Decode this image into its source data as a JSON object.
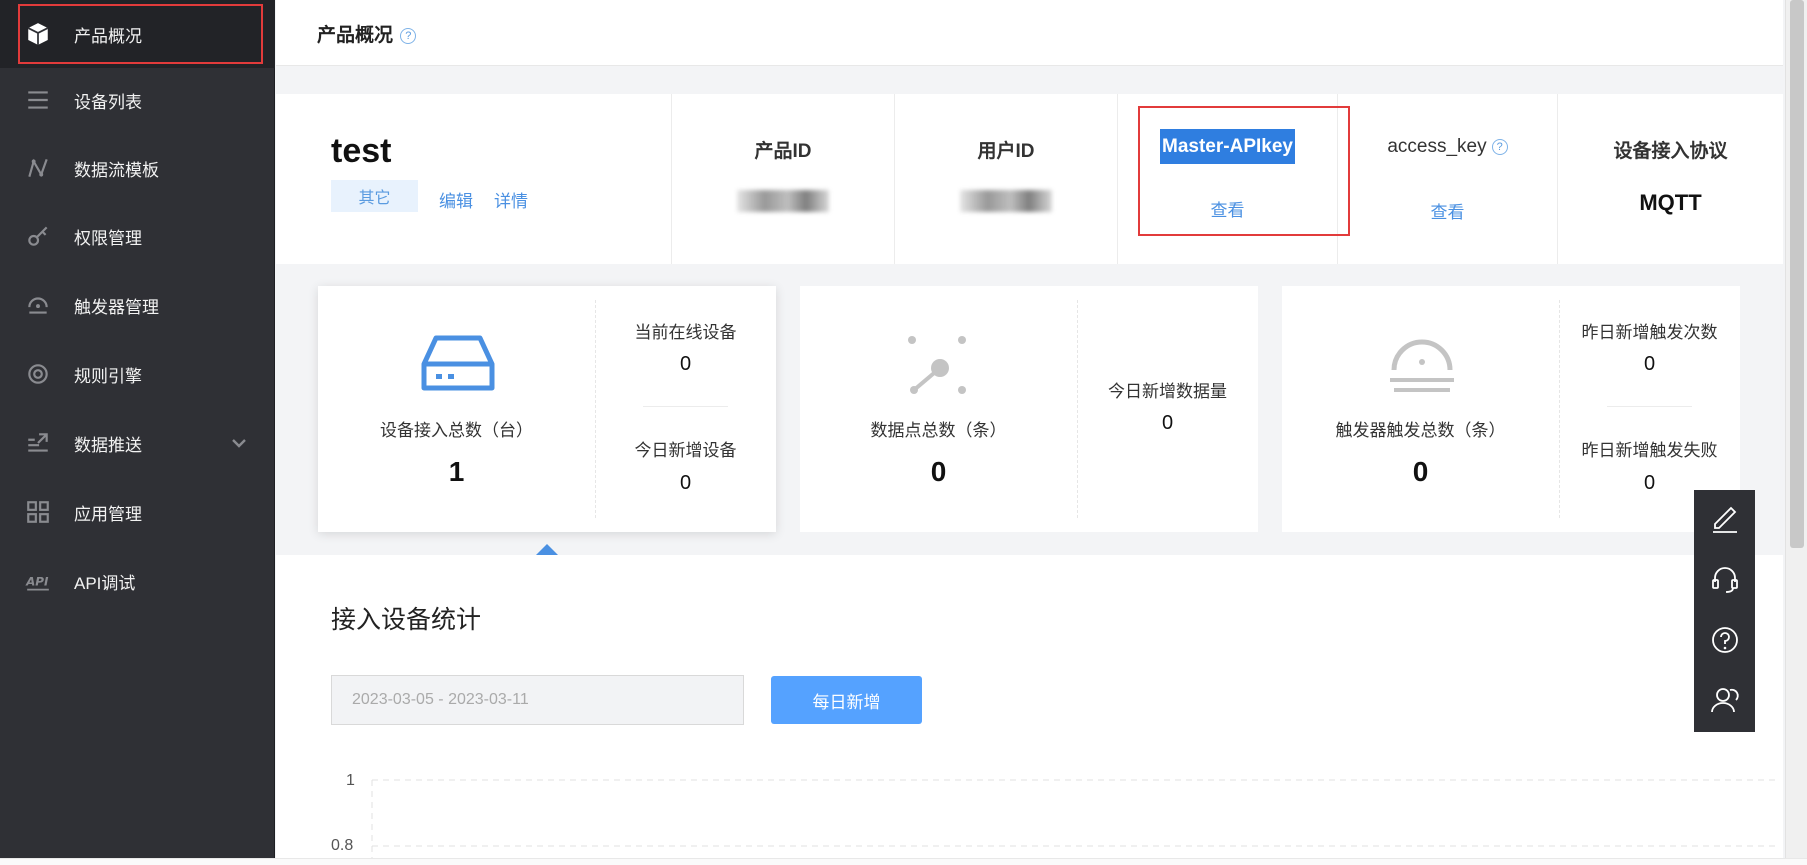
{
  "sidebar": {
    "items": [
      {
        "label": "产品概况",
        "icon": "cube-icon"
      },
      {
        "label": "设备列表",
        "icon": "list-icon"
      },
      {
        "label": "数据流模板",
        "icon": "dataflow-icon"
      },
      {
        "label": "权限管理",
        "icon": "key-icon"
      },
      {
        "label": "触发器管理",
        "icon": "trigger-icon"
      },
      {
        "label": "规则引擎",
        "icon": "rule-engine-icon"
      },
      {
        "label": "数据推送",
        "icon": "push-icon"
      },
      {
        "label": "应用管理",
        "icon": "apps-grid-icon"
      },
      {
        "label": "API调试",
        "icon": "api-icon"
      }
    ]
  },
  "header": {
    "title": "产品概况",
    "help": "?"
  },
  "product": {
    "name": "test",
    "tag": "其它",
    "edit": "编辑",
    "details": "详情",
    "fields": {
      "product_id_label": "产品ID",
      "user_id_label": "用户ID",
      "master_apikey_label": "Master-APIkey",
      "master_apikey_link": "查看",
      "access_key_label": "access_key",
      "access_key_link": "查看",
      "protocol_label": "设备接入协议",
      "protocol_value": "MQTT"
    }
  },
  "cards": {
    "devices": {
      "caption": "设备接入总数（台）",
      "total": "1",
      "online_label": "当前在线设备",
      "online_value": "0",
      "new_today_label": "今日新增设备",
      "new_today_value": "0"
    },
    "datapoints": {
      "caption": "数据点总数（条）",
      "total": "0",
      "new_today_label": "今日新增数据量",
      "new_today_value": "0"
    },
    "triggers": {
      "caption": "触发器触发总数（条）",
      "total": "0",
      "yesterday_label": "昨日新增触发次数",
      "yesterday_value": "0",
      "yesterday_fail_label": "昨日新增触发失败",
      "yesterday_fail_value": "0"
    }
  },
  "stats": {
    "title": "接入设备统计",
    "date_range": "2023-03-05 - 2023-03-11",
    "daily_button": "每日新增",
    "y_ticks": [
      "1",
      "0.8"
    ]
  },
  "float_tools": [
    "edit-icon",
    "headset-icon",
    "question-icon",
    "user-support-icon"
  ],
  "colors": {
    "accent": "#55a2ff",
    "sidebar": "#2f3035",
    "highlight": "#e23b3b"
  }
}
